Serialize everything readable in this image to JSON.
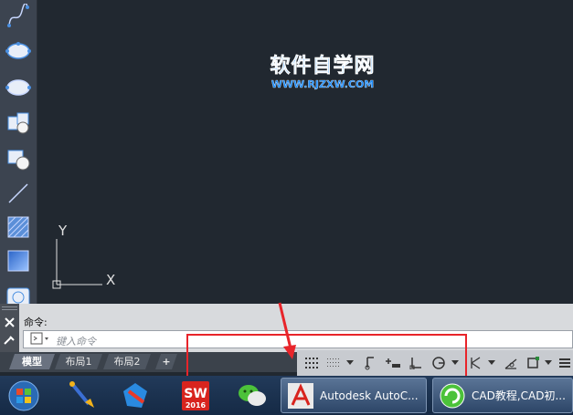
{
  "toolbar": {
    "tools": [
      "spline-icon",
      "ellipse-icon",
      "ellipse-arc-icon",
      "insert-block-icon",
      "make-block-icon",
      "point-icon",
      "hatch-icon",
      "gradient-icon",
      "region-icon"
    ]
  },
  "watermark": {
    "title": "软件自学网",
    "url": "WWW.RJZXW.COM"
  },
  "ucs": {
    "y_label": "Y",
    "x_label": "X"
  },
  "command": {
    "label": "命令:",
    "placeholder": "键入命令"
  },
  "layout_tabs": {
    "model": "模型",
    "layout1": "布局1",
    "layout2": "布局2",
    "add": "+"
  },
  "taskbar": {
    "autocad_label": "Autodesk AutoC...",
    "browser_label": "CAD教程,CAD初...",
    "sw_label": "SW",
    "sw_year": "2016"
  },
  "colors": {
    "canvas": "#212830",
    "annotation": "#e8242a",
    "watermark": "#1a8cff"
  }
}
